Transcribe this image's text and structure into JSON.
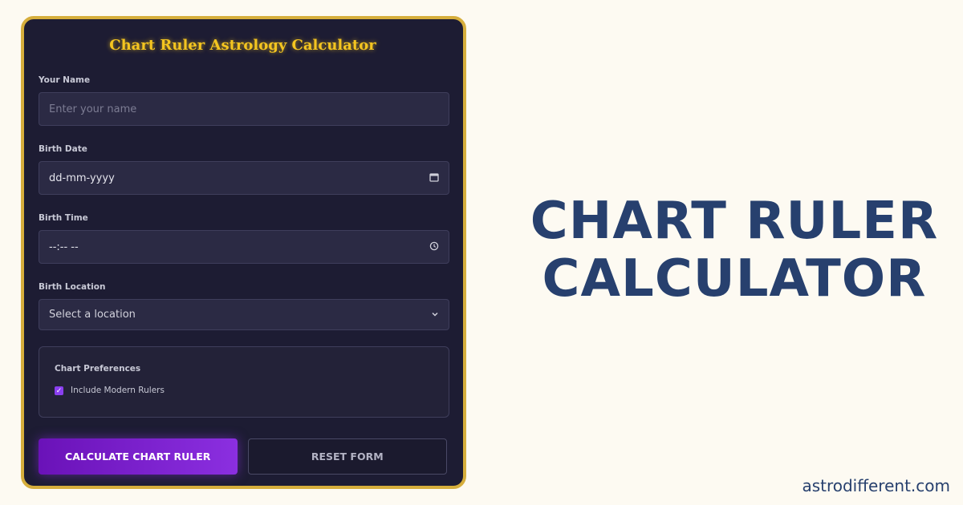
{
  "form": {
    "title": "Chart Ruler Astrology Calculator",
    "name_label": "Your Name",
    "name_placeholder": "Enter your name",
    "date_label": "Birth Date",
    "date_value": "dd-mm-yyyy",
    "time_label": "Birth Time",
    "time_value": "--:-- --",
    "location_label": "Birth Location",
    "location_selected": "Select a location",
    "preferences_title": "Chart Preferences",
    "modern_rulers_label": "Include Modern Rulers",
    "modern_rulers_checked": true,
    "calculate_button": "CALCULATE CHART RULER",
    "reset_button": "RESET FORM"
  },
  "hero": {
    "line1": "CHART RULER",
    "line2": "CALCULATOR"
  },
  "site": "astrodifferent.com",
  "icons": {
    "date": "calendar-icon",
    "time": "clock-icon",
    "location": "chevron-down-icon",
    "checkbox": "check-icon"
  },
  "colors": {
    "page_bg": "#fdfaf2",
    "card_bg": "#1d1c33",
    "card_border": "#d6ae3c",
    "title": "#f4c520",
    "accent": "#8b2fe0",
    "hero_text": "#27406e"
  }
}
